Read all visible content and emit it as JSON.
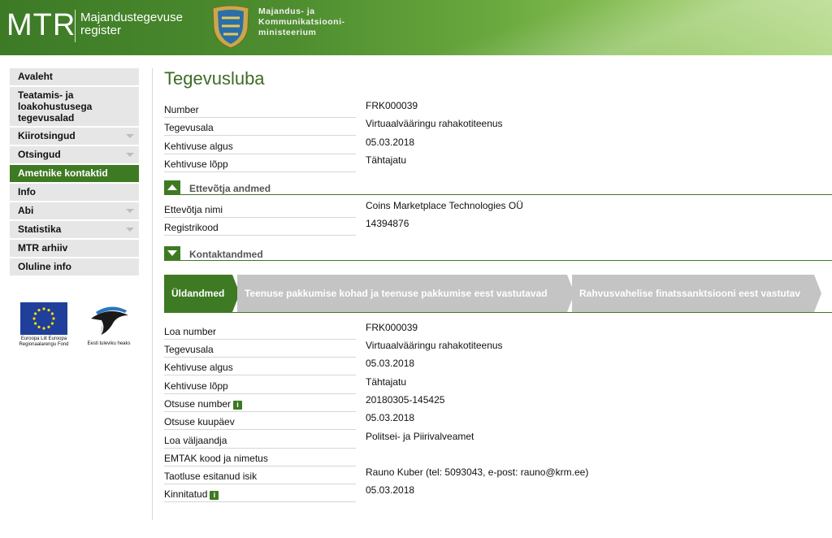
{
  "header": {
    "logo": "MTR",
    "logo_subtitle": "Majandustegevuse register",
    "ministry": "Majandus- ja Kommunikatsiooni- ministeerium"
  },
  "sidebar": {
    "items": [
      {
        "label": "Avaleht",
        "has_arrow": false,
        "active": false
      },
      {
        "label": "Teatamis- ja loakohustusega tegevusalad",
        "has_arrow": false,
        "active": false
      },
      {
        "label": "Kiirotsingud",
        "has_arrow": true,
        "active": false
      },
      {
        "label": "Otsingud",
        "has_arrow": true,
        "active": false
      },
      {
        "label": "Ametnike kontaktid",
        "has_arrow": false,
        "active": true
      },
      {
        "label": "Info",
        "has_arrow": false,
        "active": false
      },
      {
        "label": "Abi",
        "has_arrow": true,
        "active": false
      },
      {
        "label": "Statistika",
        "has_arrow": true,
        "active": false
      },
      {
        "label": "MTR arhiiv",
        "has_arrow": false,
        "active": false
      },
      {
        "label": "Oluline info",
        "has_arrow": false,
        "active": false
      }
    ],
    "eu_logo_text": "Euroopa Liit Euroopa Regionaalarengu Fond",
    "ee_logo_text": "Eesti tuleviku heaks"
  },
  "main": {
    "title": "Tegevusluba",
    "general": [
      {
        "label": "Number",
        "value": "FRK000039"
      },
      {
        "label": "Tegevusala",
        "value": "Virtuaalvääringu rahakotiteenus"
      },
      {
        "label": "Kehtivuse algus",
        "value": "05.03.2018"
      },
      {
        "label": "Kehtivuse lõpp",
        "value": "Tähtajatu"
      }
    ],
    "company_section": {
      "title": "Ettevõtja andmed",
      "rows": [
        {
          "label": "Ettevõtja nimi",
          "value": "Coins Marketplace Technologies OÜ"
        },
        {
          "label": "Registrikood",
          "value": "14394876"
        }
      ]
    },
    "contact_section": {
      "title": "Kontaktandmed"
    },
    "tabs": [
      {
        "label": "Üldandmed",
        "active": true
      },
      {
        "label": "Teenuse pakkumise kohad ja teenuse pakkumise eest vastutavad isikud",
        "active": false
      },
      {
        "label": "Rahvusvahelise finatssanktsiooni eest vastutav isik",
        "active": false
      }
    ],
    "details": [
      {
        "label": "Loa number",
        "value": "FRK000039",
        "info": false
      },
      {
        "label": "Tegevusala",
        "value": "Virtuaalvääringu rahakotiteenus",
        "info": false
      },
      {
        "label": "Kehtivuse algus",
        "value": "05.03.2018",
        "info": false
      },
      {
        "label": "Kehtivuse lõpp",
        "value": "Tähtajatu",
        "info": false
      },
      {
        "label": "Otsuse number",
        "value": "20180305-145425",
        "info": true
      },
      {
        "label": "Otsuse kuupäev",
        "value": "05.03.2018",
        "info": false
      },
      {
        "label": "Loa väljaandja",
        "value": "Politsei- ja Piirivalveamet",
        "info": false
      },
      {
        "label": "EMTAK kood ja nimetus",
        "value": "",
        "info": false
      },
      {
        "label": "Taotluse esitanud isik",
        "value": "Rauno Kuber (tel: 5093043, e-post: rauno@krm.ee)",
        "info": false
      },
      {
        "label": "Kinnitatud",
        "value": "05.03.2018",
        "info": true
      }
    ],
    "info_icon_glyph": "i"
  },
  "colors": {
    "brand_green": "#3e7a23",
    "title_green": "#3e6b26",
    "tab_inactive": "#c4c4c4",
    "nav_bg": "#e6e6e6"
  }
}
